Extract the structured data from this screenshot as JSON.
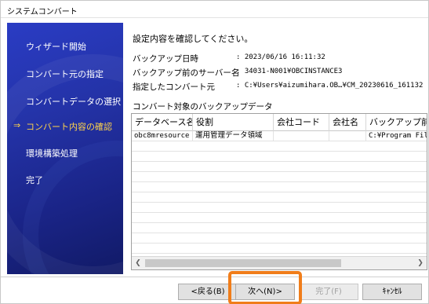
{
  "window": {
    "title": "システムコンバート"
  },
  "sidebar": {
    "items": [
      {
        "label": "ウィザード開始",
        "active": false
      },
      {
        "label": "コンバート元の指定",
        "active": false
      },
      {
        "label": "コンバートデータの選択",
        "active": false
      },
      {
        "label": "コンバート内容の確認",
        "active": true,
        "marker": "⇒"
      },
      {
        "label": "環境構築処理",
        "active": false
      },
      {
        "label": "完了",
        "active": false
      }
    ]
  },
  "main": {
    "instruction": "設定内容を確認してください。",
    "info": [
      {
        "label": "バックアップ日時",
        "value": ": 2023/06/16 16:11:32"
      },
      {
        "label": "バックアップ前のサーバー名",
        "value": ": 34031-N001¥OBCINSTANCE3"
      },
      {
        "label": "指定したコンバート元",
        "value": ": C:¥Users¥aizumihara.OB…¥CM_20230616_161132"
      }
    ],
    "backup_section_label": "コンバート対象のバックアップデータ",
    "table": {
      "columns": [
        "データベース名",
        "役割",
        "会社コード",
        "会社名",
        "バックアップ前の"
      ],
      "rows": [
        [
          "obc8mresource",
          "運用管理データ領域",
          "",
          "",
          "C:¥Program Files"
        ]
      ]
    }
  },
  "buttons": {
    "back": "<戻る(B)",
    "next": "次へ(N)>",
    "finish": "完了(F)",
    "cancel": "ｷｬﾝｾﾙ"
  },
  "colors": {
    "sidebar_top": "#2a3cc4",
    "sidebar_bottom": "#111a66",
    "active_text": "#ffd34a",
    "highlight": "#f07d1a"
  },
  "icons": {
    "scroll_left": "chevron-left-icon",
    "scroll_right": "chevron-right-icon"
  }
}
